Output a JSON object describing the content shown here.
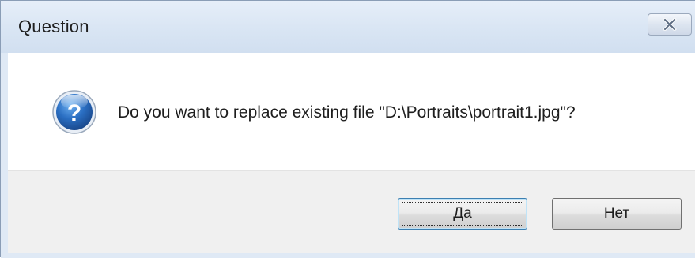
{
  "dialog": {
    "title": "Question",
    "message": "Do you want to replace existing file \"D:\\Portraits\\portrait1.jpg\"?",
    "icon": "question-icon",
    "close_icon": "close-icon"
  },
  "buttons": {
    "yes": {
      "accel": "Д",
      "rest": "а"
    },
    "no": {
      "accel": "Н",
      "rest": "ет"
    }
  },
  "colors": {
    "frame": "#dfe9f5",
    "footer": "#f0f0f0",
    "icon_blue": "#2a6ec2",
    "default_button_border": "#3c7fb1"
  }
}
